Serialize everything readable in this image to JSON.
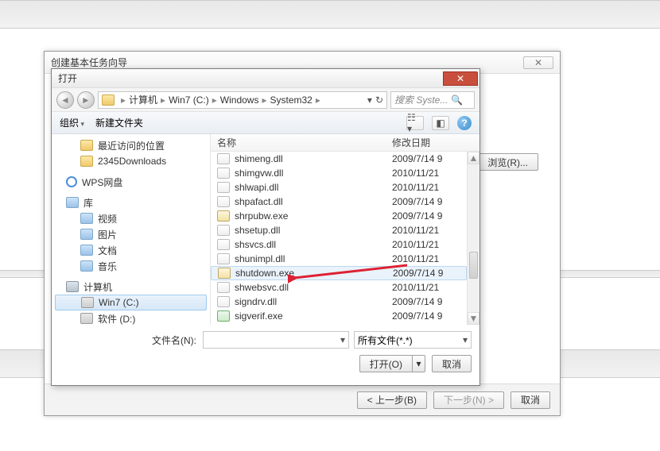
{
  "wizard": {
    "title": "创建基本任务向导",
    "browse": "浏览(R)...",
    "back": "< 上一步(B)",
    "next": "下一步(N) >",
    "cancel": "取消"
  },
  "open": {
    "title": "打开",
    "search_placeholder": "搜索 Syste...",
    "toolbar": {
      "organize": "组织",
      "newfolder": "新建文件夹"
    },
    "filename_label": "文件名(N):",
    "filename_value": "",
    "filter": "所有文件(*.*)",
    "open_btn": "打开(O)",
    "cancel_btn": "取消"
  },
  "breadcrumb": [
    "计算机",
    "Win7 (C:)",
    "Windows",
    "System32"
  ],
  "sidebar": {
    "recent": "最近访问的位置",
    "downloads": "2345Downloads",
    "wps": "WPS网盘",
    "lib": "库",
    "lib_items": [
      "视频",
      "图片",
      "文档",
      "音乐"
    ],
    "pc": "计算机",
    "drives": [
      "Win7 (C:)",
      "软件 (D:)"
    ]
  },
  "filelist": {
    "hdr_name": "名称",
    "hdr_date": "修改日期",
    "rows": [
      {
        "name": "shimeng.dll",
        "date": "2009/7/14 9",
        "type": "dll"
      },
      {
        "name": "shimgvw.dll",
        "date": "2010/11/21",
        "type": "dll"
      },
      {
        "name": "shlwapi.dll",
        "date": "2010/11/21",
        "type": "dll"
      },
      {
        "name": "shpafact.dll",
        "date": "2009/7/14 9",
        "type": "dll"
      },
      {
        "name": "shrpubw.exe",
        "date": "2009/7/14 9",
        "type": "exe"
      },
      {
        "name": "shsetup.dll",
        "date": "2010/11/21",
        "type": "dll"
      },
      {
        "name": "shsvcs.dll",
        "date": "2010/11/21",
        "type": "dll"
      },
      {
        "name": "shunimpl.dll",
        "date": "2010/11/21",
        "type": "dll"
      },
      {
        "name": "shutdown.exe",
        "date": "2009/7/14 9",
        "type": "exe",
        "hl": true
      },
      {
        "name": "shwebsvc.dll",
        "date": "2010/11/21",
        "type": "dll"
      },
      {
        "name": "signdrv.dll",
        "date": "2009/7/14 9",
        "type": "dll"
      },
      {
        "name": "sigverif.exe",
        "date": "2009/7/14 9",
        "type": "exe-green"
      }
    ]
  }
}
